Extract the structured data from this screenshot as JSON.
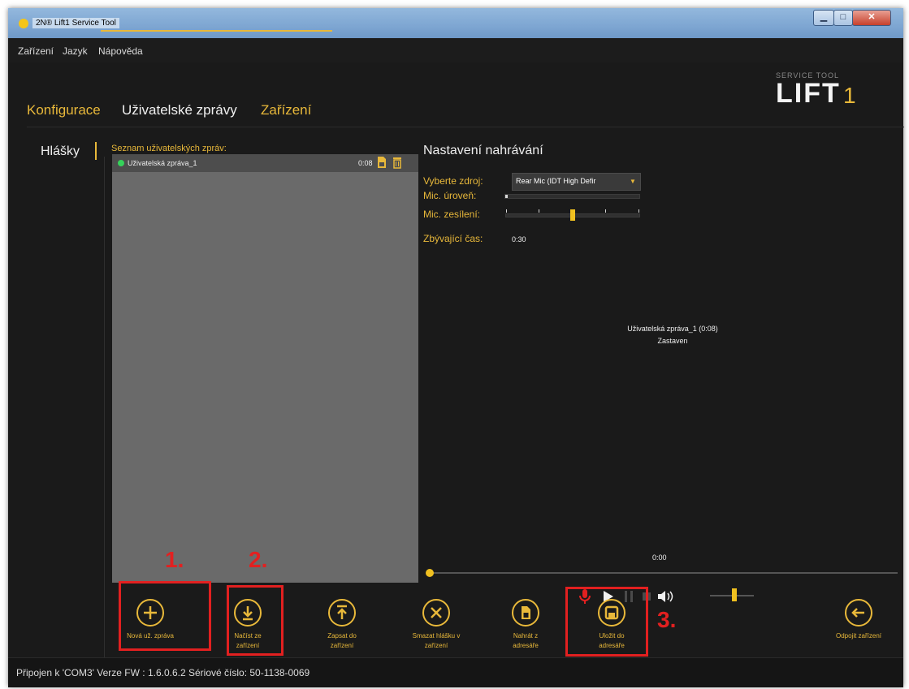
{
  "window": {
    "title": "2N® Lift1 Service Tool"
  },
  "menu": [
    "Zařízení",
    "Jazyk",
    "Nápověda"
  ],
  "logo": {
    "small": "SERVICE TOOL",
    "big": "LIFT",
    "number": "1"
  },
  "tabs": [
    "Konfigurace",
    "Uživatelské zprávy",
    "Zařízení"
  ],
  "sidebar": {
    "label": "Hlášky"
  },
  "message_list": {
    "title": "Seznam uživatelských zpráv:",
    "items": [
      {
        "name": "Uživatelská zpráva_1",
        "duration": "0:08",
        "status_color": "#35d15a"
      }
    ]
  },
  "recording": {
    "title": "Nastavení nahrávání",
    "source_label": "Vyberte zdroj:",
    "source_value": "Rear Mic (IDT High Defir",
    "mic_level_label": "Mic. úroveň:",
    "mic_level_fraction": 0.02,
    "mic_gain_label": "Mic. zesílení:",
    "mic_gain_fraction": 0.5,
    "remaining_label": "Zbývající čas:",
    "remaining_value": "0:30"
  },
  "player": {
    "now_playing": "Uživatelská zpráva_1 (0:08)",
    "state": "Zastaven",
    "position": "0:00",
    "progress_fraction": 0.0,
    "volume_fraction": 0.55
  },
  "actions": [
    {
      "label": "Nová už. zpráva",
      "icon": "plus-icon"
    },
    {
      "label": "Načíst ze\nzařízení",
      "icon": "download-icon"
    },
    {
      "label": "Zapsat do\nzařízení",
      "icon": "upload-icon"
    },
    {
      "label": "Smazat hlášku v\nzařízení",
      "icon": "x-icon"
    },
    {
      "label": "Nahrát z\nadresáře",
      "icon": "file-icon"
    },
    {
      "label": "Uložit do\nadresáře",
      "icon": "save-icon"
    },
    {
      "label": "Odpojit zařízení",
      "icon": "arrow-left-icon"
    }
  ],
  "annotations": [
    "1.",
    "2.",
    "3."
  ],
  "status_bar": "Připojen k 'COM3'   Verze FW : 1.6.0.6.2   Sériové číslo: 50-1138-0069",
  "colors": {
    "accent": "#e8b83a",
    "background": "#1a1a1a",
    "list_panel": "#6a6a6a",
    "annotation": "#e22020"
  }
}
